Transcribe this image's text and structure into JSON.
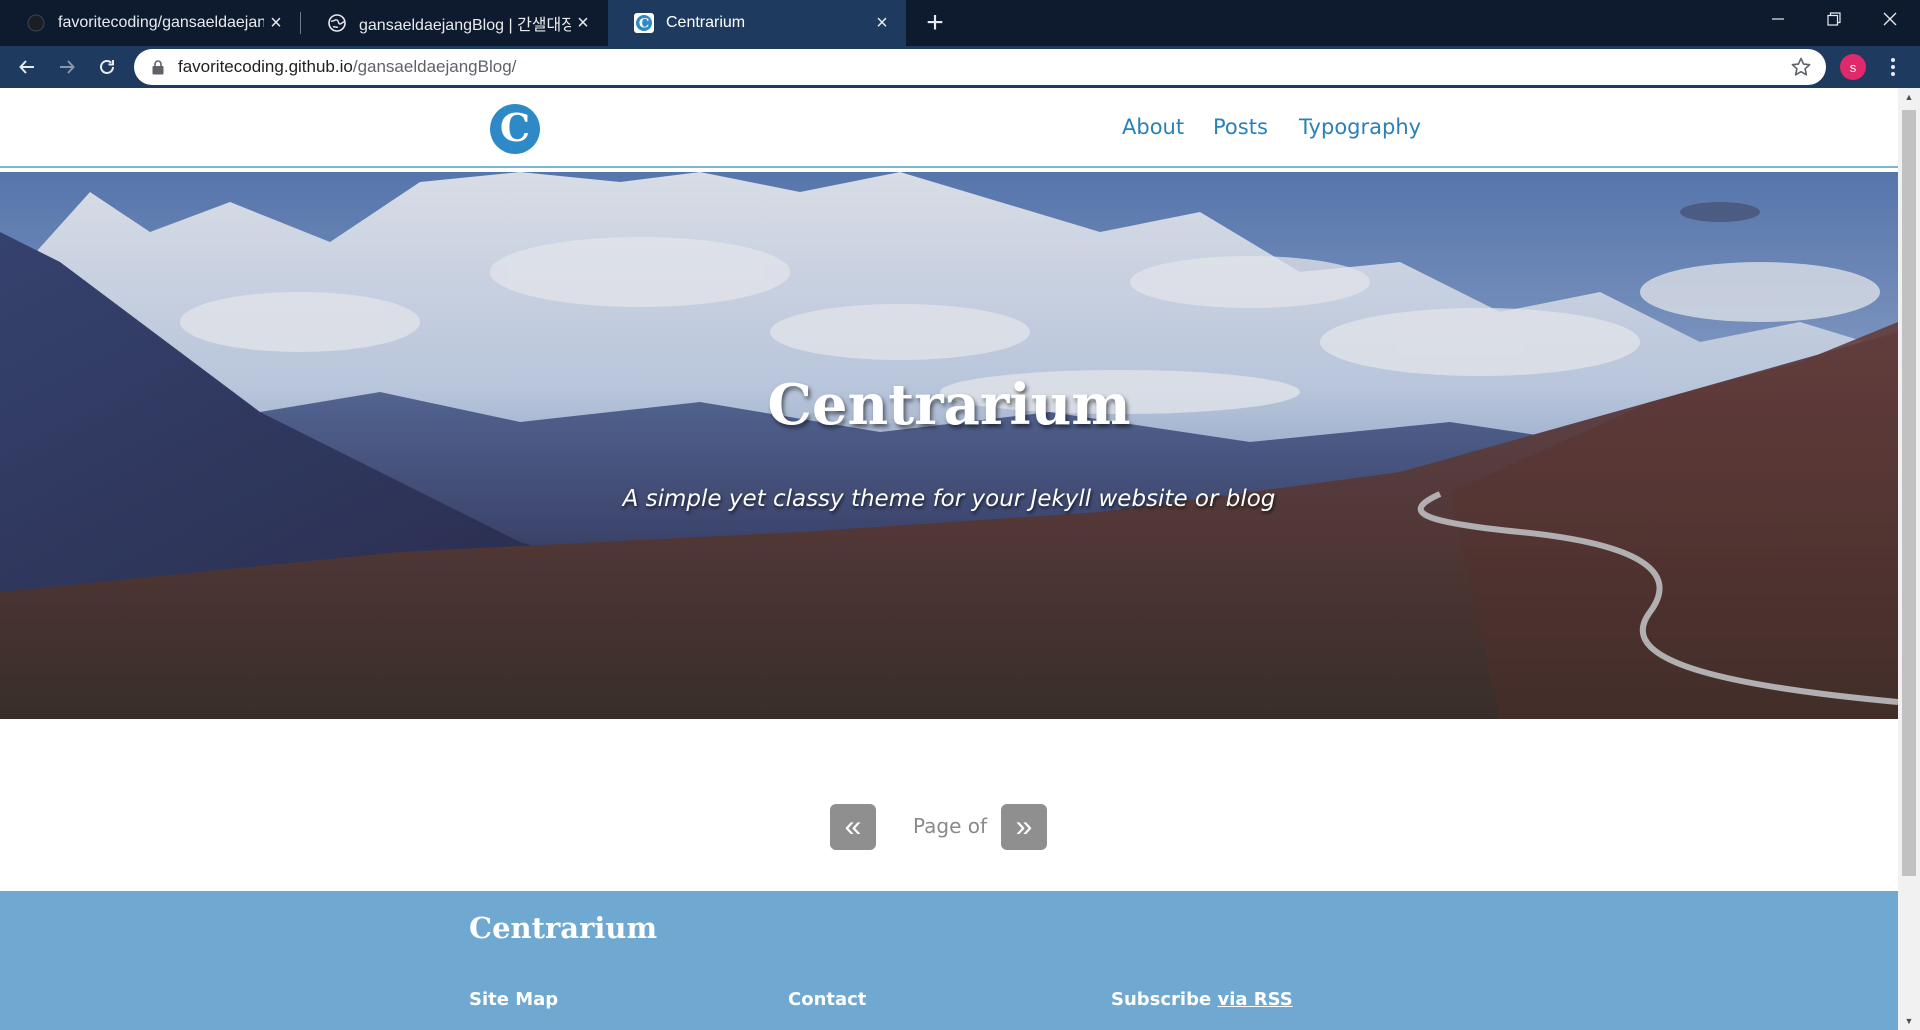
{
  "browser": {
    "tabs": [
      {
        "title": "favoritecoding/gansaeldaejangBlog",
        "icon": "github-icon",
        "active": false
      },
      {
        "title": "gansaeldaejangBlog | 간샐대장 블로그",
        "icon": "globe-icon",
        "active": false
      },
      {
        "title": "Centrarium",
        "icon": "centrarium-logo-icon",
        "active": true
      }
    ],
    "url_host": "favoritecoding.github.io",
    "url_path": "/gansaeldaejangBlog/",
    "profile_initial": "s",
    "accent": "#1e3a5f",
    "tabbar_color": "#0e1b2f"
  },
  "site": {
    "logo_letter": "C",
    "nav": [
      "About",
      "Posts",
      "Typography"
    ],
    "hero_title": "Centrarium",
    "hero_subtitle": "A simple yet classy theme for your Jekyll website or blog",
    "pagination": {
      "prev_glyph": "«",
      "label": "Page of",
      "next_glyph": "»"
    },
    "footer": {
      "title": "Centrarium",
      "columns": {
        "site_map": "Site Map",
        "contact": "Contact",
        "subscribe": "Subscribe",
        "subscribe_link": "via RSS"
      }
    },
    "link_color": "#2a80b9",
    "footer_color": "#6fa8d0"
  }
}
